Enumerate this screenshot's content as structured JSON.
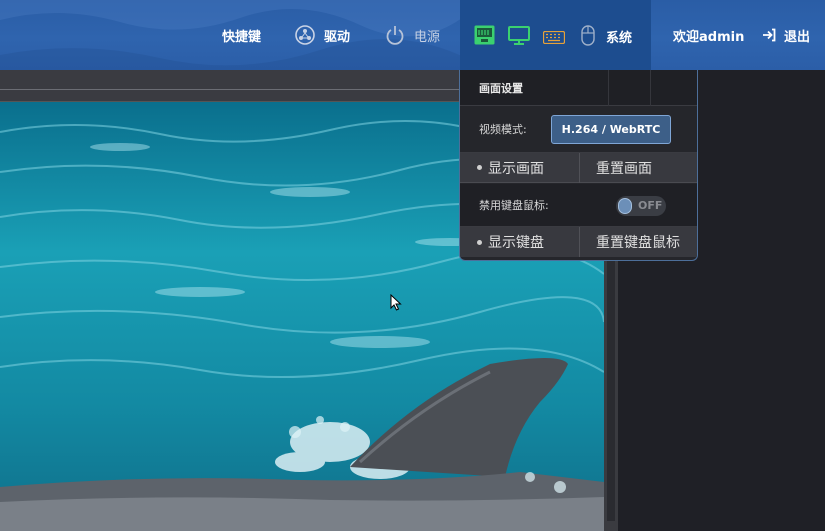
{
  "topbar": {
    "shortcuts": "快捷键",
    "driver": "驱动",
    "power": "电源",
    "system": "系统",
    "welcome": "欢迎admin",
    "logout": "退出"
  },
  "panel": {
    "title": "画面设置",
    "mode_label": "视频模式:",
    "mode_value": "H.264 / WebRTC",
    "show_screen": "显示画面",
    "reset_screen": "重置画面",
    "disable_kbm_label": "禁用键盘鼠标:",
    "toggle_state": "OFF",
    "show_keyboard": "显示键盘",
    "reset_kbm": "重置键盘鼠标"
  },
  "colors": {
    "topbar": "#2f64ae",
    "accent_green": "#3bd16f",
    "accent_orange": "#e5a13a",
    "mode_button": "#3d5f88"
  },
  "icons": [
    "driver-icon",
    "power-icon",
    "network-icon",
    "monitor-icon",
    "keyboard-icon",
    "mouse-icon",
    "logout-icon"
  ]
}
